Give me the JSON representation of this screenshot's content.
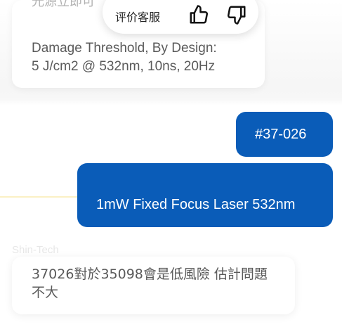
{
  "feedback": {
    "label": "评价客服",
    "thumb_up_icon": "thumbs-up-icon",
    "thumb_down_icon": "thumbs-down-icon"
  },
  "messages": {
    "top_card": {
      "faded_text": "光源立即可",
      "text": "Damage Threshold, By Design:\n5 J/cm2 @ 532nm, 10ns, 20Hz"
    },
    "user_1": {
      "text": "#37-026"
    },
    "user_2": {
      "text": "1mW Fixed Focus Laser 532nm"
    },
    "sender_name": "Shin-Tech",
    "bottom_card": {
      "text": "37026對於35098會是低風險 估計問題不大"
    }
  },
  "colors": {
    "user_bubble": "#0a5cb8",
    "card_text": "#5a5a5a"
  }
}
